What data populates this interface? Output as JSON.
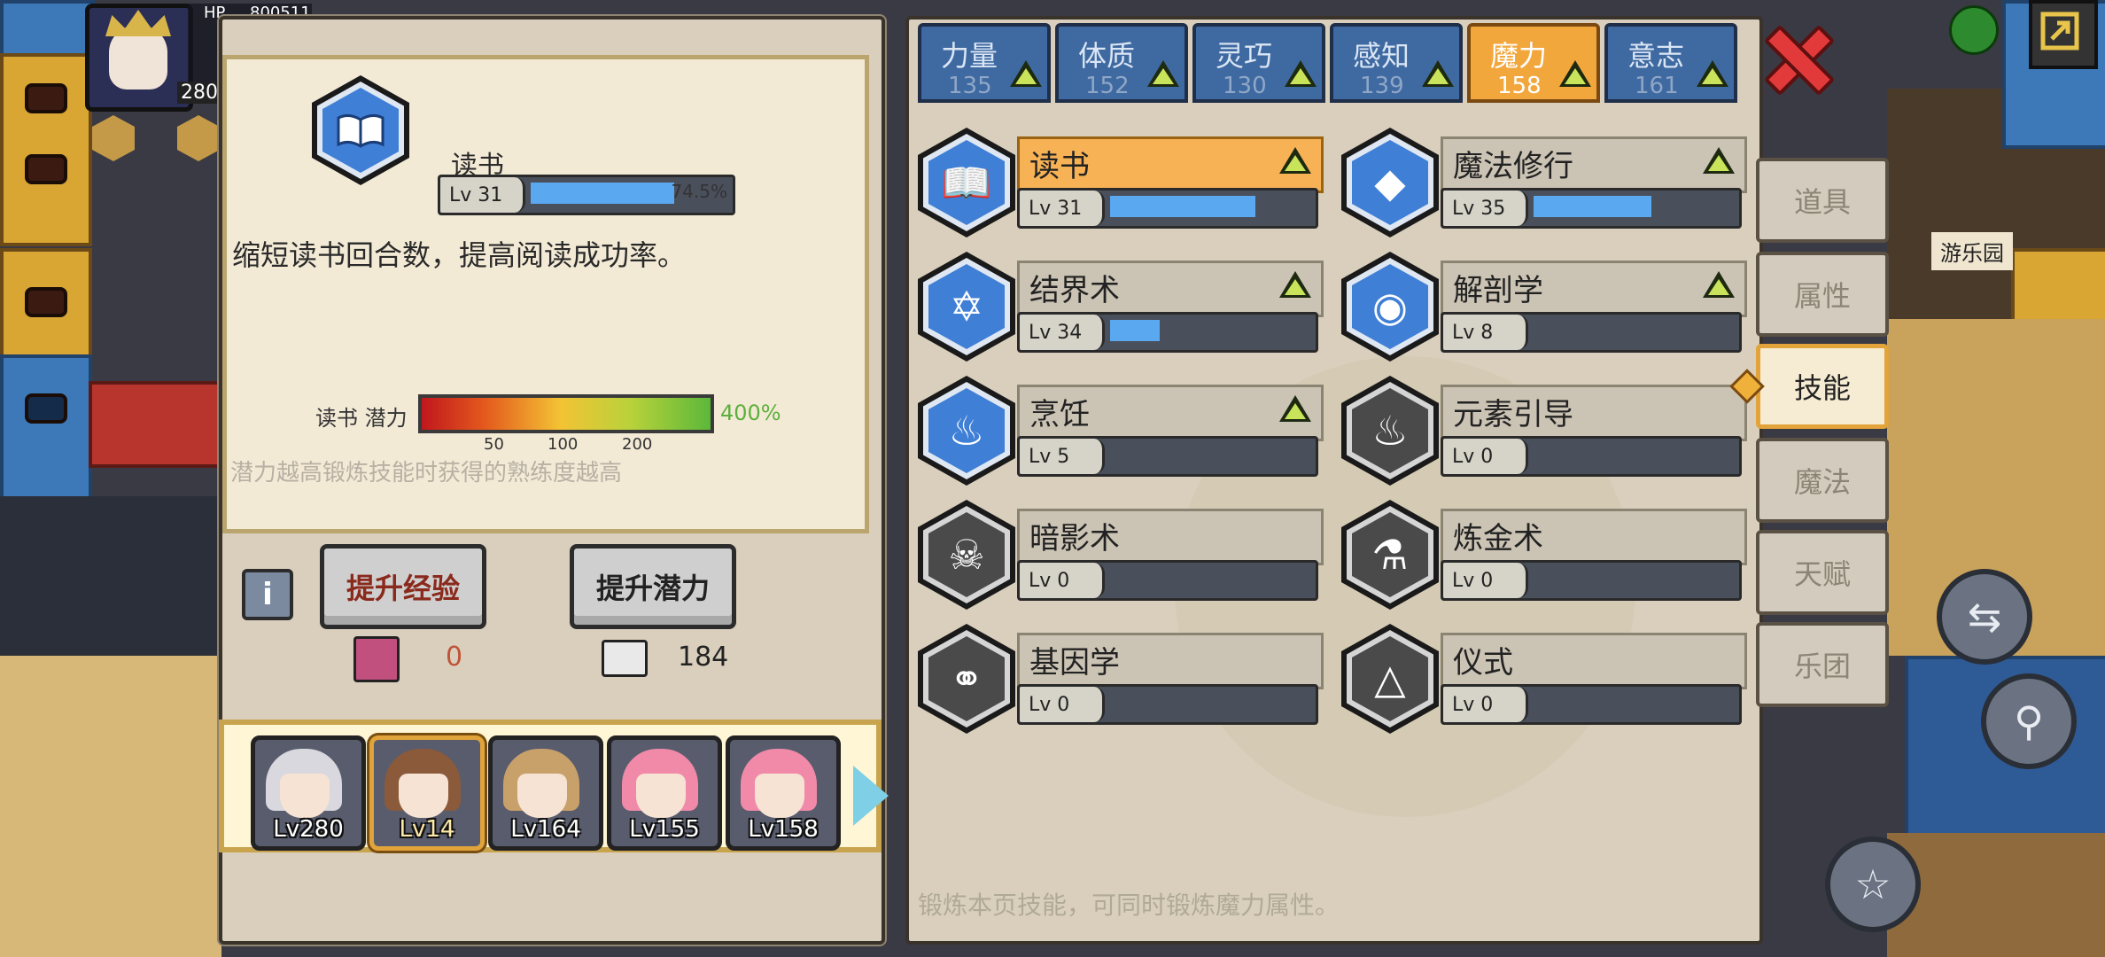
{
  "selected_skill": {
    "name": "读书",
    "level": "Lv 31",
    "progress_pct": "74.5%",
    "progress": 0.745,
    "description": "缩短读书回合数，提高阅读成功率。",
    "potential_label": "读书 潜力",
    "potential_value": "400%",
    "potential_ticks": [
      "50",
      "100",
      "200"
    ],
    "potential_note": "潜力越高锻炼技能时获得的熟练度越高"
  },
  "actions": {
    "exp_button": "提升经验",
    "potential_button": "提升潜力",
    "exp_resource": "0",
    "potential_resource": "184"
  },
  "team": [
    {
      "level": "Lv280"
    },
    {
      "level": "Lv14"
    },
    {
      "level": "Lv164"
    },
    {
      "level": "Lv155"
    },
    {
      "level": "Lv158"
    }
  ],
  "attribute_tabs": [
    {
      "name": "力量",
      "value": "135"
    },
    {
      "name": "体质",
      "value": "152"
    },
    {
      "name": "灵巧",
      "value": "130"
    },
    {
      "name": "感知",
      "value": "139"
    },
    {
      "name": "魔力",
      "value": "158"
    },
    {
      "name": "意志",
      "value": "161"
    }
  ],
  "skills": [
    {
      "name": "读书",
      "level": "Lv 31",
      "progress": 0.74,
      "upgradable": true,
      "icon": "book-icon"
    },
    {
      "name": "魔法修行",
      "level": "Lv 35",
      "progress": 0.6,
      "upgradable": true,
      "icon": "magic-crystal-icon"
    },
    {
      "name": "结界术",
      "level": "Lv 34",
      "progress": 0.25,
      "upgradable": true,
      "icon": "hexagram-icon"
    },
    {
      "name": "解剖学",
      "level": "Lv 8",
      "progress": 0,
      "upgradable": true,
      "icon": "meat-icon"
    },
    {
      "name": "烹饪",
      "level": "Lv 5",
      "progress": 0,
      "upgradable": true,
      "icon": "pot-icon"
    },
    {
      "name": "元素引导",
      "level": "Lv 0",
      "progress": 0,
      "upgradable": false,
      "icon": "element-flame-icon"
    },
    {
      "name": "暗影术",
      "level": "Lv 0",
      "progress": 0,
      "upgradable": false,
      "icon": "skull-flame-icon"
    },
    {
      "name": "炼金术",
      "level": "Lv 0",
      "progress": 0,
      "upgradable": false,
      "icon": "flask-icon"
    },
    {
      "name": "基因学",
      "level": "Lv 0",
      "progress": 0,
      "upgradable": false,
      "icon": "molecule-icon"
    },
    {
      "name": "仪式",
      "level": "Lv 0",
      "progress": 0,
      "upgradable": false,
      "icon": "candle-icon"
    }
  ],
  "footer_note": "锻炼本页技能，可同时锻炼魔力属性。",
  "side_menu": [
    "道具",
    "属性",
    "技能",
    "魔法",
    "天赋",
    "乐团"
  ],
  "side_menu_active": "技能",
  "hud": {
    "hp_label": "HP",
    "hp_value": "800511",
    "level": "280"
  },
  "world_labels": {
    "park": "游乐园"
  },
  "colors": {
    "accent": "#f2a73d",
    "tab_blue": "#3f6aa1",
    "bar_blue": "#5aa8f0",
    "potential_green": "#5caf3c"
  }
}
